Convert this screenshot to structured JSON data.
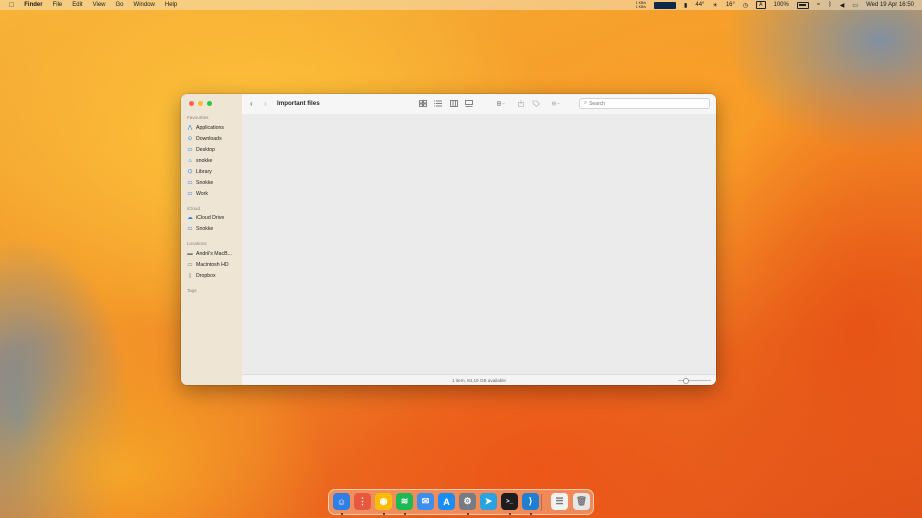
{
  "menubar": {
    "app_name": "Finder",
    "menus": [
      "File",
      "Edit",
      "View",
      "Go",
      "Window",
      "Help"
    ],
    "net_up": "1 KB/s",
    "net_down": "1 KB/s",
    "temp1": "44°",
    "temp2": "16°",
    "input_source": "A",
    "battery": "100%",
    "datetime": "Wed 19 Apr  16:50"
  },
  "window": {
    "title": "Important files",
    "search_placeholder": "Search",
    "status": "1 item, 84,19 GB available",
    "zoom_level": 0.25
  },
  "sidebar": {
    "sections": [
      {
        "title": "Favourites",
        "items": [
          {
            "label": "Applications",
            "icon": "applications-icon"
          },
          {
            "label": "Downloads",
            "icon": "downloads-icon"
          },
          {
            "label": "Desktop",
            "icon": "desktop-icon"
          },
          {
            "label": "snokke",
            "icon": "home-icon"
          },
          {
            "label": "Library",
            "icon": "library-icon"
          },
          {
            "label": "Snokke",
            "icon": "folder-icon"
          },
          {
            "label": "Work",
            "icon": "folder-icon"
          }
        ]
      },
      {
        "title": "iCloud",
        "items": [
          {
            "label": "iCloud Drive",
            "icon": "icloud-icon"
          },
          {
            "label": "Snokke",
            "icon": "folder-icon"
          }
        ]
      },
      {
        "title": "Locations",
        "items": [
          {
            "label": "Andrii's MacB...",
            "icon": "laptop-icon"
          },
          {
            "label": "Macintosh HD",
            "icon": "disk-icon"
          },
          {
            "label": "Dropbox",
            "icon": "dropbox-icon"
          }
        ]
      },
      {
        "title": "Tags",
        "items": []
      }
    ]
  },
  "dock": {
    "apps": [
      {
        "name": "finder-app",
        "color": "#2f7fe6",
        "glyph": "☺",
        "running": true
      },
      {
        "name": "launchpad-app",
        "color": "#e9573f",
        "glyph": "⋮",
        "running": false
      },
      {
        "name": "chrome-app",
        "color": "#fbbc05",
        "glyph": "◉",
        "running": true
      },
      {
        "name": "spotify-app",
        "color": "#1db954",
        "glyph": "≋",
        "running": true
      },
      {
        "name": "mail-app",
        "color": "#3d8ef0",
        "glyph": "✉",
        "running": false
      },
      {
        "name": "app-store-app",
        "color": "#1a8cf7",
        "glyph": "A",
        "running": false
      },
      {
        "name": "system-settings-app",
        "color": "#777c82",
        "glyph": "⚙",
        "running": true
      },
      {
        "name": "telegram-app",
        "color": "#2aa3e0",
        "glyph": "➤",
        "running": false
      },
      {
        "name": "terminal-app",
        "color": "#1e1e1e",
        "glyph": ">_",
        "running": true
      },
      {
        "name": "vscode-app",
        "color": "#1f7fd2",
        "glyph": "⟩",
        "running": true
      },
      {
        "name": "document-app",
        "color": "#f2f2f2",
        "glyph": "☰",
        "running": false
      },
      {
        "name": "trash-app",
        "color": "#e6e6e6",
        "glyph": "🗑",
        "running": false
      }
    ]
  }
}
